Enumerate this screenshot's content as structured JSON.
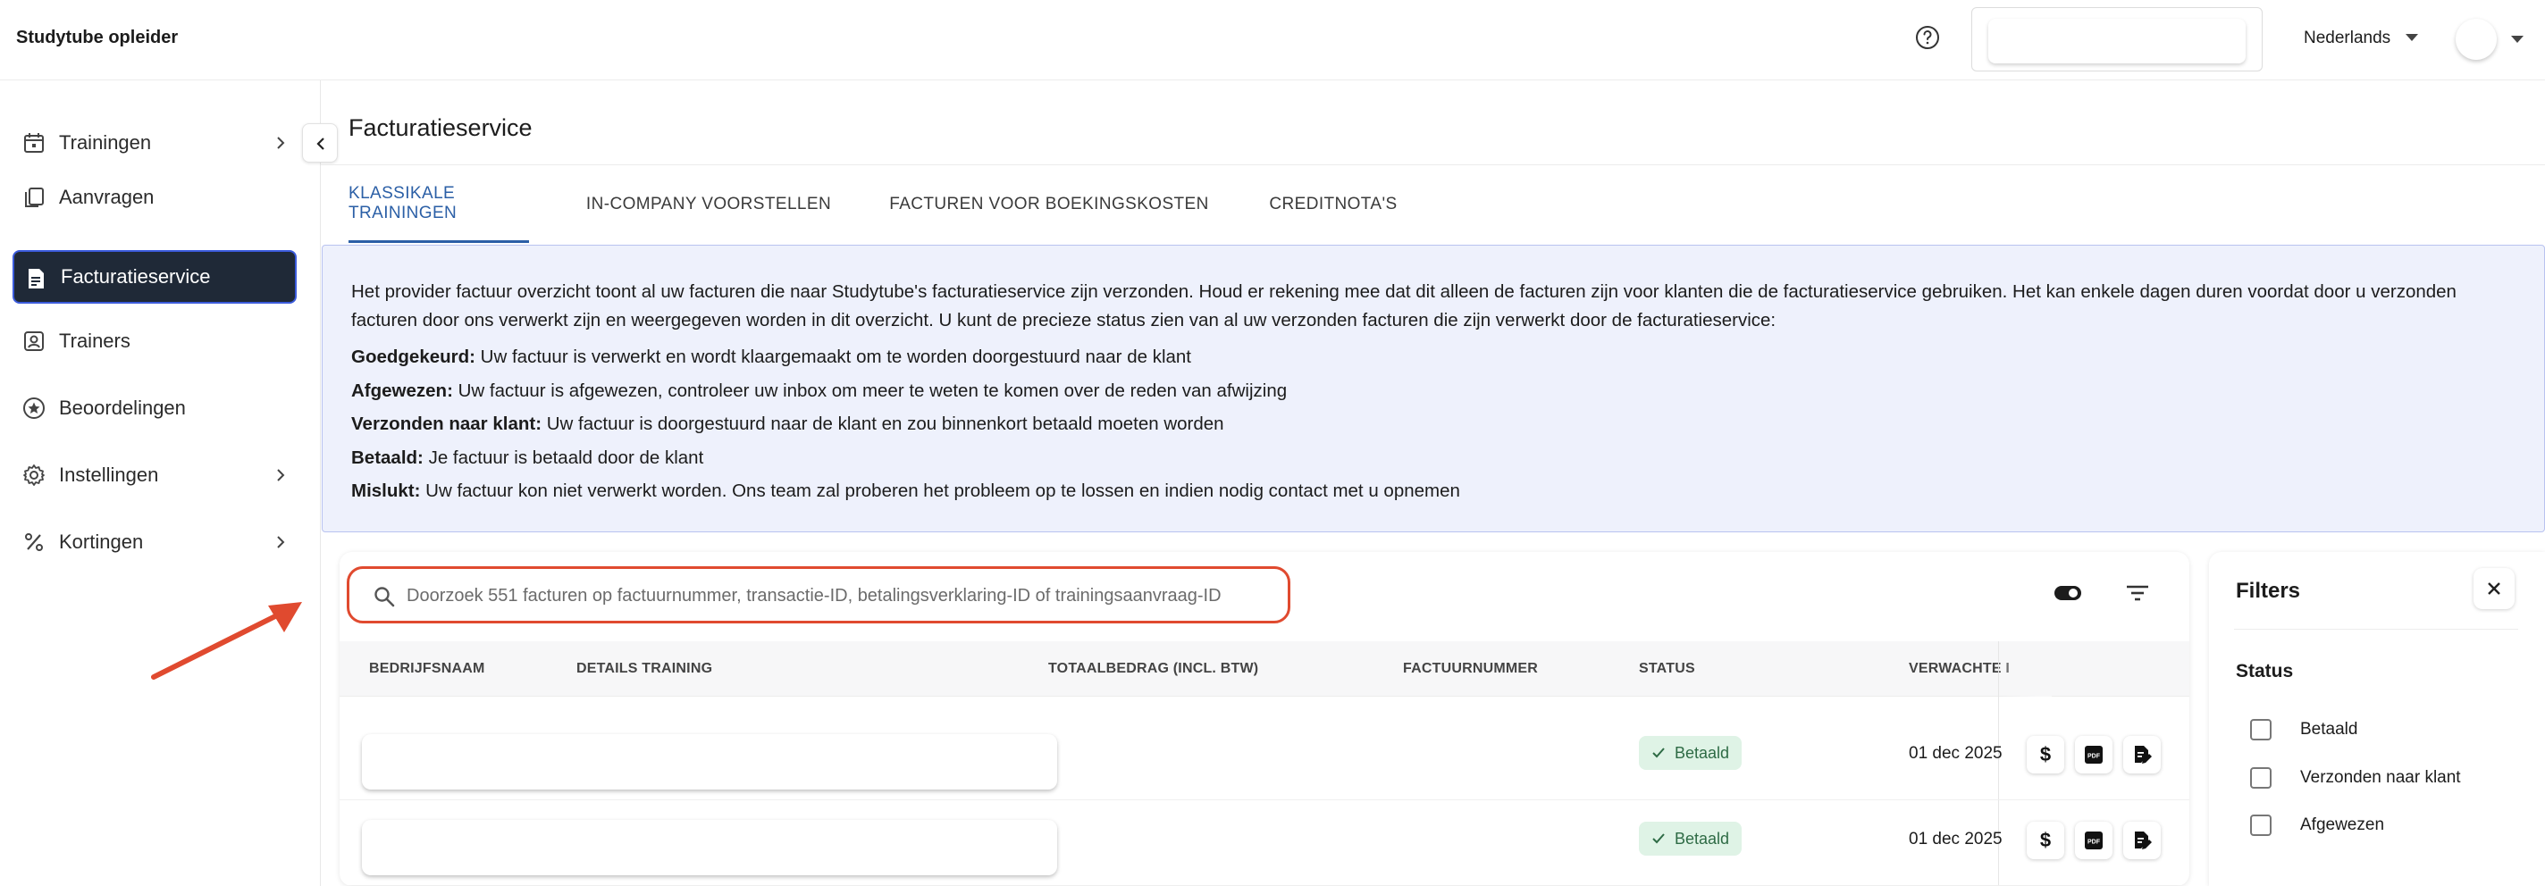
{
  "app": {
    "name": "Studytube opleider"
  },
  "header": {
    "language": "Nederlands"
  },
  "sidebar": {
    "items": [
      {
        "label": "Trainingen",
        "icon": "calendar-icon",
        "expandable": true
      },
      {
        "label": "Aanvragen",
        "icon": "copy-icon",
        "expandable": false
      },
      {
        "label": "Facturatieservice",
        "icon": "invoice-icon",
        "expandable": false,
        "active": true
      },
      {
        "label": "Trainers",
        "icon": "person-badge-icon",
        "expandable": false
      },
      {
        "label": "Beoordelingen",
        "icon": "star-circle-icon",
        "expandable": false
      },
      {
        "label": "Instellingen",
        "icon": "gear-icon",
        "expandable": true
      },
      {
        "label": "Kortingen",
        "icon": "percent-icon",
        "expandable": true
      }
    ]
  },
  "page": {
    "title": "Facturatieservice"
  },
  "tabs": [
    {
      "label": "KLASSIKALE TRAININGEN",
      "active": true
    },
    {
      "label": "IN-COMPANY VOORSTELLEN",
      "active": false
    },
    {
      "label": "FACTUREN VOOR BOEKINGSKOSTEN",
      "active": false
    },
    {
      "label": "CREDITNOTA'S",
      "active": false
    }
  ],
  "info": {
    "intro": "Het provider factuur overzicht toont al uw facturen die naar Studytube's facturatieservice zijn verzonden. Houd er rekening mee dat dit alleen de facturen zijn voor klanten die de facturatieservice gebruiken. Het kan enkele dagen duren voordat door u verzonden facturen door ons verwerkt zijn en weergegeven worden in dit overzicht. U kunt de precieze status zien van al uw verzonden facturen die zijn verwerkt door de facturatieservice:",
    "lines": [
      {
        "term": "Goedgekeurd:",
        "text": " Uw factuur is verwerkt en wordt klaargemaakt om te worden doorgestuurd naar de klant"
      },
      {
        "term": "Afgewezen:",
        "text": " Uw factuur is afgewezen, controleer uw inbox om meer te weten te komen over de reden van afwijzing"
      },
      {
        "term": "Verzonden naar klant:",
        "text": " Uw factuur is doorgestuurd naar de klant en zou binnenkort betaald moeten worden"
      },
      {
        "term": "Betaald:",
        "text": " Je factuur is betaald door de klant"
      },
      {
        "term": "Mislukt:",
        "text": " Uw factuur kon niet verwerkt worden. Ons team zal proberen het probleem op te lossen en indien nodig contact met u opnemen"
      }
    ]
  },
  "search": {
    "placeholder": "Doorzoek 551 facturen op factuurnummer, transactie-ID, betalingsverklaring-ID of trainingsaanvraag-ID"
  },
  "table": {
    "columns": [
      "BEDRIJFSNAAM",
      "DETAILS TRAINING",
      "TOTAALBEDRAG (INCL. BTW)",
      "FACTUURNUMMER",
      "STATUS",
      "VERWACHTE I"
    ],
    "rows": [
      {
        "status": "Betaald",
        "date": "01 dec 2025"
      },
      {
        "status": "Betaald",
        "date": "01 dec 2025"
      }
    ],
    "actions": {
      "dollar": "$",
      "pdf": "PDF"
    }
  },
  "filters": {
    "title": "Filters",
    "status_label": "Status",
    "options": [
      "Betaald",
      "Verzonden naar klant",
      "Afgewezen"
    ]
  },
  "colors": {
    "accent": "#2b5fa6",
    "sidebar_active": "#1f2937",
    "highlight": "#e04a2f",
    "info_bg": "#eef1fc",
    "badge_bg": "#dff3e6"
  }
}
